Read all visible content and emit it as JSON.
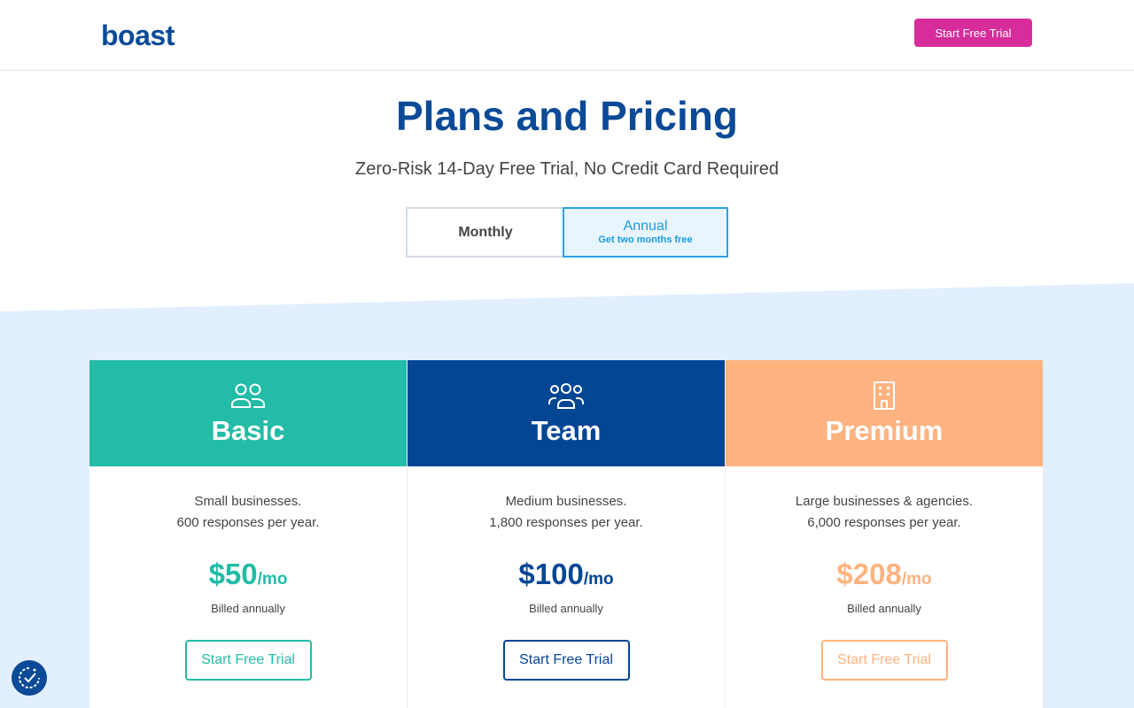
{
  "header": {
    "logo_text": "boast",
    "cta_label": "Start Free Trial"
  },
  "hero": {
    "title": "Plans and Pricing",
    "subtitle": "Zero-Risk 14-Day Free Trial, No Credit Card Required"
  },
  "billing_toggle": {
    "monthly_label": "Monthly",
    "annual_label": "Annual",
    "annual_note": "Get two months free",
    "selected": "Annual"
  },
  "plans": [
    {
      "name": "Basic",
      "icon": "users-icon",
      "color": "#22bca7",
      "audience": "Small businesses.",
      "responses": "600 responses per year.",
      "price": "$50",
      "unit": "/mo",
      "billing": "Billed annually",
      "cta_label": "Start Free Trial"
    },
    {
      "name": "Team",
      "icon": "team-icon",
      "color": "#034694",
      "audience": "Medium businesses.",
      "responses": "1,800 responses per year.",
      "price": "$100",
      "unit": "/mo",
      "billing": "Billed annually",
      "cta_label": "Start Free Trial"
    },
    {
      "name": "Premium",
      "icon": "building-icon",
      "color": "#feb380",
      "audience": "Large businesses & agencies.",
      "responses": "6,000 responses per year.",
      "price": "$208",
      "unit": "/mo",
      "billing": "Billed annually",
      "cta_label": "Start Free Trial"
    }
  ],
  "colors": {
    "brand": "#0b4a97",
    "header_cta": "#d62d9b",
    "pricing_background": "#e2efff",
    "toggle_active": "#2aa3e6"
  },
  "accessibility_widget": {
    "icon": "accessibility-icon"
  }
}
